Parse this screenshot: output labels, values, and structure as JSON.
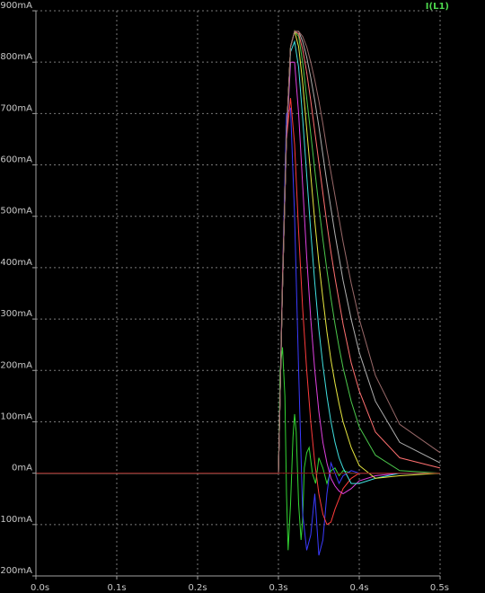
{
  "chart_data": {
    "type": "line",
    "title": "",
    "xlabel": "",
    "ylabel": "",
    "x_unit": "s",
    "y_unit": "mA",
    "xlim": [
      0,
      0.5
    ],
    "ylim": [
      -200,
      900
    ],
    "x_ticks": [
      0,
      0.1,
      0.2,
      0.3,
      0.4,
      0.5
    ],
    "y_ticks": [
      -200,
      -100,
      0,
      100,
      200,
      300,
      400,
      500,
      600,
      700,
      800,
      900
    ],
    "x_tick_labels": [
      "0.0s",
      "0.1s",
      "0.2s",
      "0.3s",
      "0.4s",
      "0.5s"
    ],
    "y_tick_labels": [
      "-200mA",
      "-100mA",
      "0mA",
      "100mA",
      "200mA",
      "300mA",
      "400mA",
      "500mA",
      "600mA",
      "700mA",
      "800mA",
      "900mA"
    ],
    "grid": true,
    "legend": {
      "label": "I(L1)",
      "position": "top-right",
      "color": "#4cd64c"
    },
    "background_color": "#000000",
    "axis_color": "#a0a0a0",
    "grid_color": "#7a7a7a",
    "series": [
      {
        "color": "#33d633",
        "x": [
          0,
          0.3,
          0.302,
          0.305,
          0.308,
          0.31,
          0.312,
          0.315,
          0.318,
          0.32,
          0.322,
          0.325,
          0.328,
          0.33,
          0.332,
          0.335,
          0.338,
          0.342,
          0.346,
          0.35,
          0.355,
          0.36,
          0.365,
          0.37,
          0.375,
          0.38,
          0.39,
          0.4,
          0.42,
          0.45,
          0.5
        ],
        "y": [
          0,
          0,
          200,
          245,
          150,
          -40,
          -150,
          -60,
          70,
          115,
          80,
          -60,
          -130,
          -90,
          10,
          40,
          50,
          0,
          -20,
          30,
          10,
          -20,
          5,
          10,
          -5,
          5,
          0,
          0,
          0,
          0,
          0
        ]
      },
      {
        "color": "#3b3bff",
        "x": [
          0,
          0.3,
          0.305,
          0.31,
          0.315,
          0.32,
          0.325,
          0.33,
          0.335,
          0.34,
          0.345,
          0.35,
          0.355,
          0.36,
          0.365,
          0.37,
          0.375,
          0.38,
          0.39,
          0.4,
          0.42,
          0.45,
          0.5
        ],
        "y": [
          0,
          0,
          380,
          700,
          710,
          500,
          200,
          -80,
          -150,
          -120,
          -40,
          -160,
          -130,
          -40,
          20,
          0,
          -20,
          -5,
          5,
          0,
          0,
          0,
          0
        ]
      },
      {
        "color": "#ff3b3b",
        "x": [
          0,
          0.3,
          0.305,
          0.31,
          0.315,
          0.32,
          0.325,
          0.33,
          0.335,
          0.34,
          0.345,
          0.35,
          0.355,
          0.36,
          0.365,
          0.37,
          0.375,
          0.38,
          0.39,
          0.4,
          0.42,
          0.45,
          0.5
        ],
        "y": [
          0,
          0,
          380,
          650,
          730,
          640,
          470,
          320,
          200,
          100,
          20,
          -40,
          -80,
          -100,
          -95,
          -70,
          -50,
          -30,
          -10,
          0,
          0,
          0,
          0
        ]
      },
      {
        "color": "#e040e0",
        "x": [
          0,
          0.3,
          0.305,
          0.31,
          0.315,
          0.32,
          0.325,
          0.33,
          0.335,
          0.34,
          0.345,
          0.35,
          0.355,
          0.36,
          0.365,
          0.37,
          0.375,
          0.38,
          0.39,
          0.4,
          0.42,
          0.45,
          0.5
        ],
        "y": [
          0,
          0,
          360,
          650,
          800,
          800,
          700,
          560,
          420,
          300,
          200,
          120,
          60,
          20,
          -10,
          -25,
          -35,
          -40,
          -30,
          -15,
          -5,
          0,
          0
        ]
      },
      {
        "color": "#40e0e0",
        "x": [
          0,
          0.3,
          0.305,
          0.31,
          0.315,
          0.32,
          0.325,
          0.33,
          0.335,
          0.34,
          0.345,
          0.35,
          0.355,
          0.36,
          0.365,
          0.37,
          0.375,
          0.38,
          0.39,
          0.4,
          0.42,
          0.45,
          0.5
        ],
        "y": [
          0,
          0,
          360,
          660,
          820,
          840,
          790,
          690,
          580,
          470,
          370,
          280,
          210,
          150,
          100,
          60,
          30,
          10,
          -20,
          -20,
          -10,
          0,
          0
        ]
      },
      {
        "color": "#e8e840",
        "x": [
          0,
          0.3,
          0.305,
          0.31,
          0.315,
          0.32,
          0.325,
          0.33,
          0.335,
          0.34,
          0.345,
          0.35,
          0.355,
          0.36,
          0.365,
          0.37,
          0.375,
          0.38,
          0.39,
          0.4,
          0.42,
          0.45,
          0.5
        ],
        "y": [
          0,
          0,
          360,
          660,
          830,
          860,
          830,
          760,
          670,
          580,
          490,
          410,
          340,
          275,
          220,
          175,
          135,
          100,
          50,
          15,
          -10,
          -5,
          0
        ]
      },
      {
        "color": "#4cc84c",
        "x": [
          0,
          0.3,
          0.305,
          0.31,
          0.315,
          0.32,
          0.325,
          0.33,
          0.335,
          0.34,
          0.345,
          0.35,
          0.355,
          0.36,
          0.365,
          0.37,
          0.375,
          0.38,
          0.39,
          0.4,
          0.42,
          0.45,
          0.5
        ],
        "y": [
          0,
          0,
          360,
          660,
          830,
          860,
          850,
          800,
          730,
          660,
          590,
          520,
          455,
          395,
          340,
          290,
          245,
          205,
          140,
          90,
          35,
          5,
          0
        ]
      },
      {
        "color": "#ff7070",
        "x": [
          0,
          0.3,
          0.305,
          0.31,
          0.315,
          0.32,
          0.325,
          0.33,
          0.335,
          0.34,
          0.345,
          0.35,
          0.355,
          0.36,
          0.365,
          0.37,
          0.375,
          0.38,
          0.39,
          0.4,
          0.42,
          0.45,
          0.5
        ],
        "y": [
          0,
          0,
          360,
          660,
          830,
          860,
          855,
          825,
          780,
          725,
          665,
          605,
          545,
          485,
          430,
          380,
          335,
          290,
          215,
          160,
          80,
          30,
          10
        ]
      },
      {
        "color": "#b0b0b0",
        "x": [
          0,
          0.3,
          0.305,
          0.31,
          0.315,
          0.32,
          0.325,
          0.33,
          0.335,
          0.34,
          0.345,
          0.35,
          0.355,
          0.36,
          0.365,
          0.37,
          0.375,
          0.38,
          0.39,
          0.4,
          0.42,
          0.45,
          0.5
        ],
        "y": [
          0,
          0,
          360,
          660,
          830,
          860,
          860,
          840,
          810,
          770,
          725,
          675,
          620,
          565,
          515,
          465,
          420,
          375,
          300,
          235,
          140,
          60,
          20
        ]
      },
      {
        "color": "#9a6a6a",
        "x": [
          0,
          0.3,
          0.305,
          0.31,
          0.315,
          0.32,
          0.325,
          0.33,
          0.335,
          0.34,
          0.345,
          0.35,
          0.355,
          0.36,
          0.365,
          0.37,
          0.375,
          0.38,
          0.39,
          0.4,
          0.42,
          0.45,
          0.5
        ],
        "y": [
          0,
          0,
          360,
          660,
          830,
          860,
          860,
          850,
          830,
          800,
          765,
          725,
          680,
          630,
          585,
          540,
          495,
          450,
          370,
          300,
          190,
          95,
          40
        ]
      }
    ]
  }
}
